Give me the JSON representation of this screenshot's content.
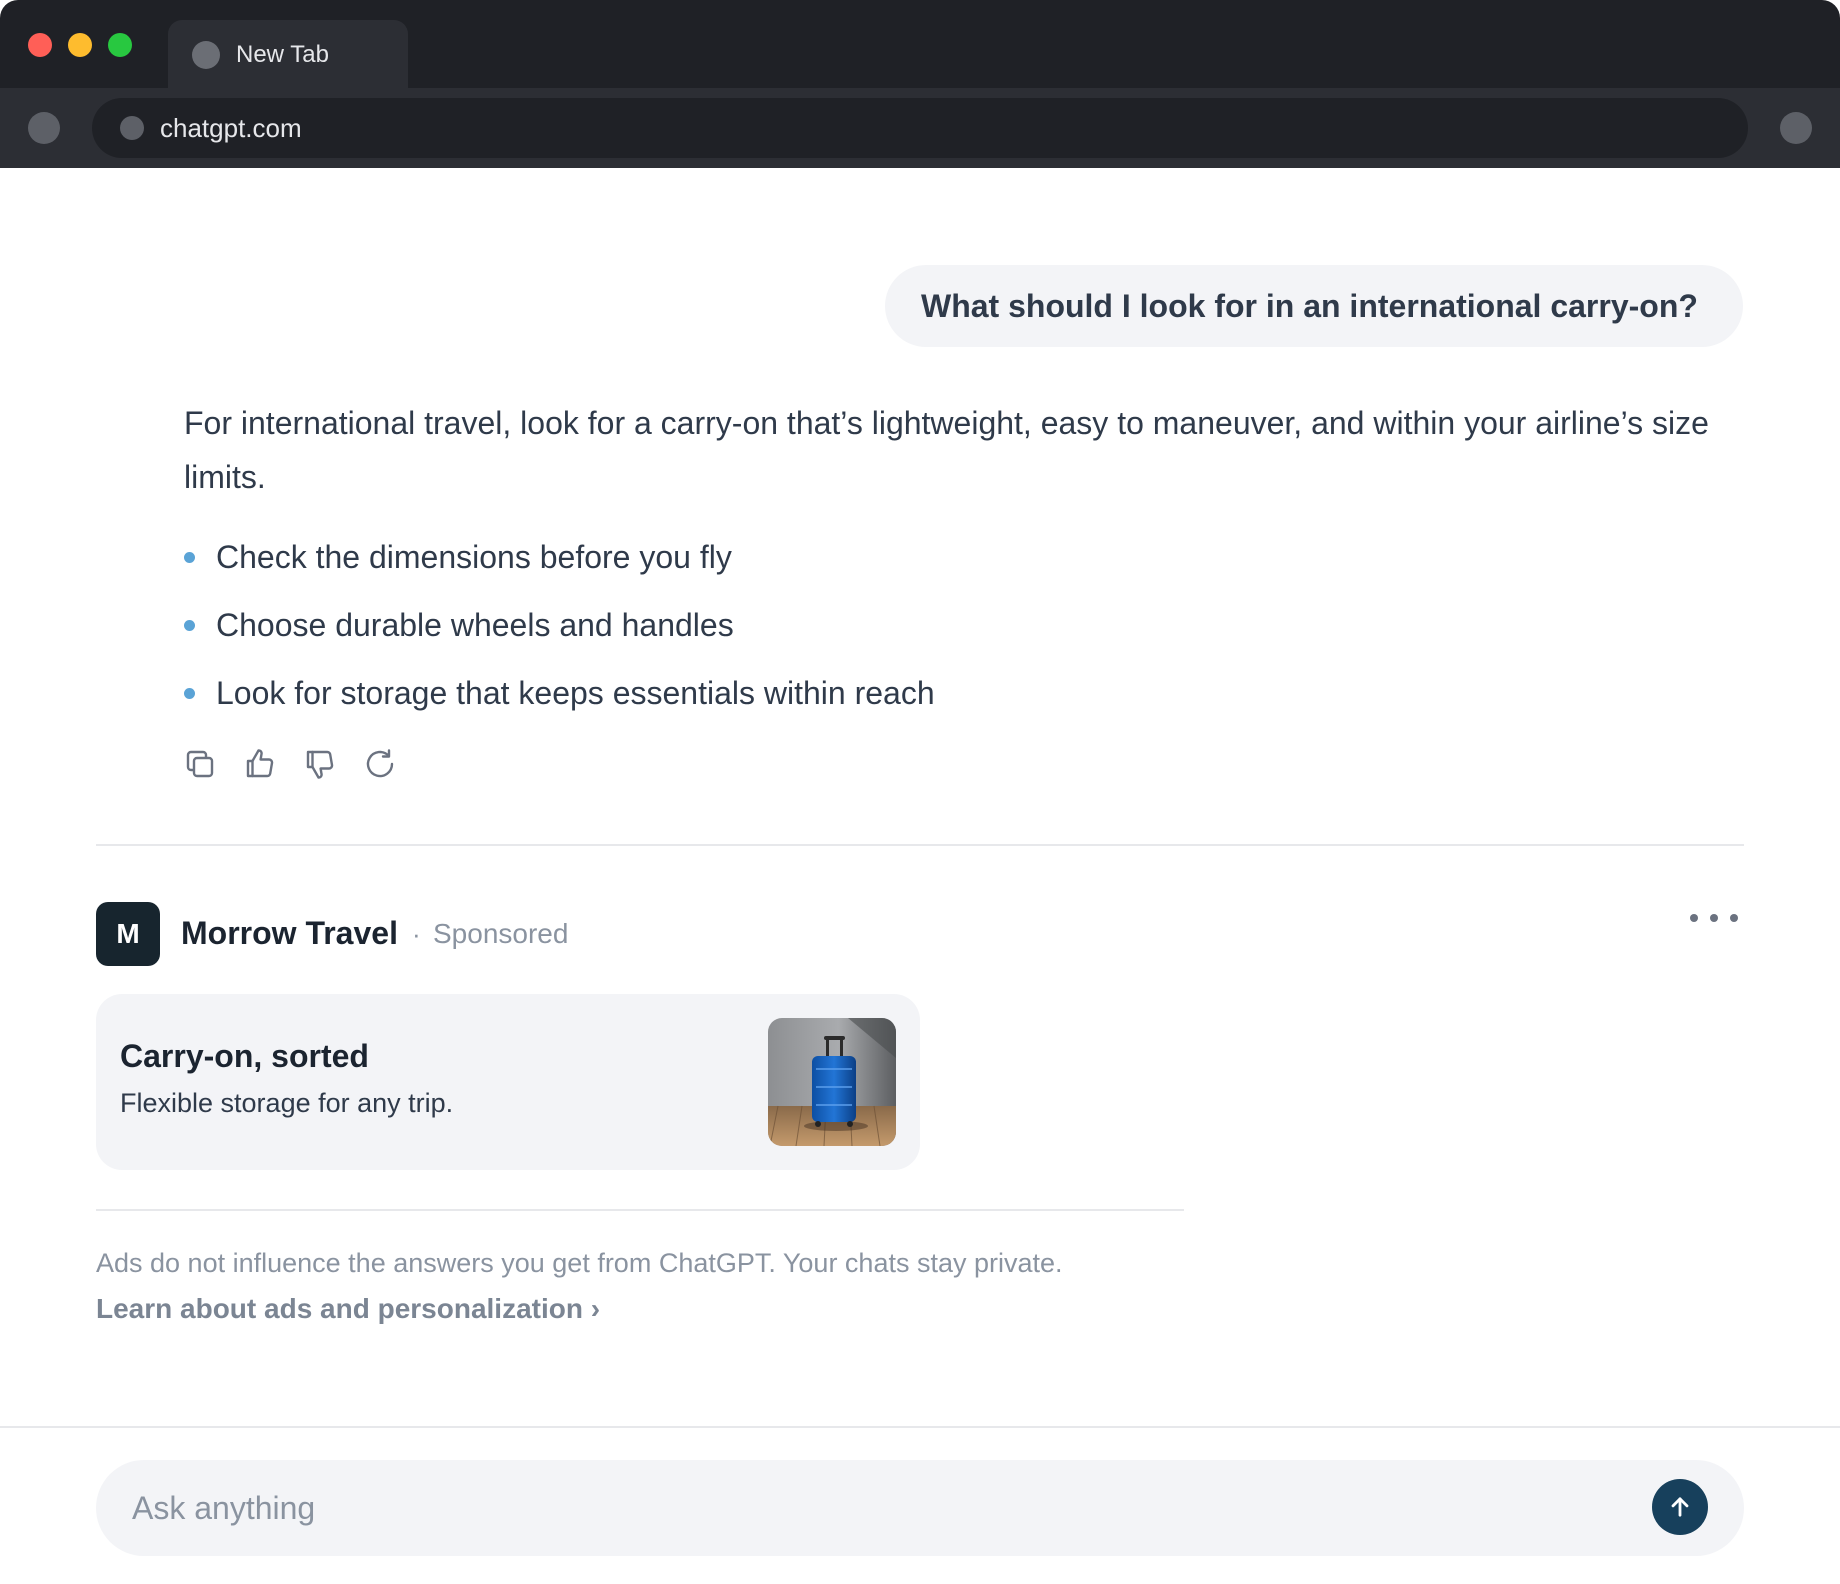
{
  "browser": {
    "tab_title": "New Tab",
    "address": "chatgpt.com"
  },
  "chat": {
    "user_message": "What should I look for in an international carry-on?",
    "assistant_intro": "For international travel, look for a carry-on that’s lightweight, easy to maneuver, and within your airline’s size limits.",
    "bullets": [
      "Check the dimensions before you fly",
      "Choose durable wheels and handles",
      "Look for storage that keeps essentials within reach"
    ],
    "actions": {
      "copy_icon": "copy-icon",
      "like_icon": "thumbs-up-icon",
      "dislike_icon": "thumbs-down-icon",
      "regenerate_icon": "refresh-icon"
    }
  },
  "sponsored": {
    "avatar_letter": "M",
    "brand_name": "Morrow Travel",
    "separator": "·",
    "label": "Sponsored",
    "ad_title": "Carry-on, sorted",
    "ad_subtitle": "Flexible storage for any trip.",
    "disclaimer": "Ads do not influence the answers you get from ChatGPT. Your chats stay private.",
    "learn_link": "Learn about ads and personalization ›"
  },
  "composer": {
    "placeholder": "Ask anything"
  },
  "colors": {
    "accent": "#17405c",
    "bullet": "#5aa3d6",
    "brand_avatar": "#17252e"
  }
}
